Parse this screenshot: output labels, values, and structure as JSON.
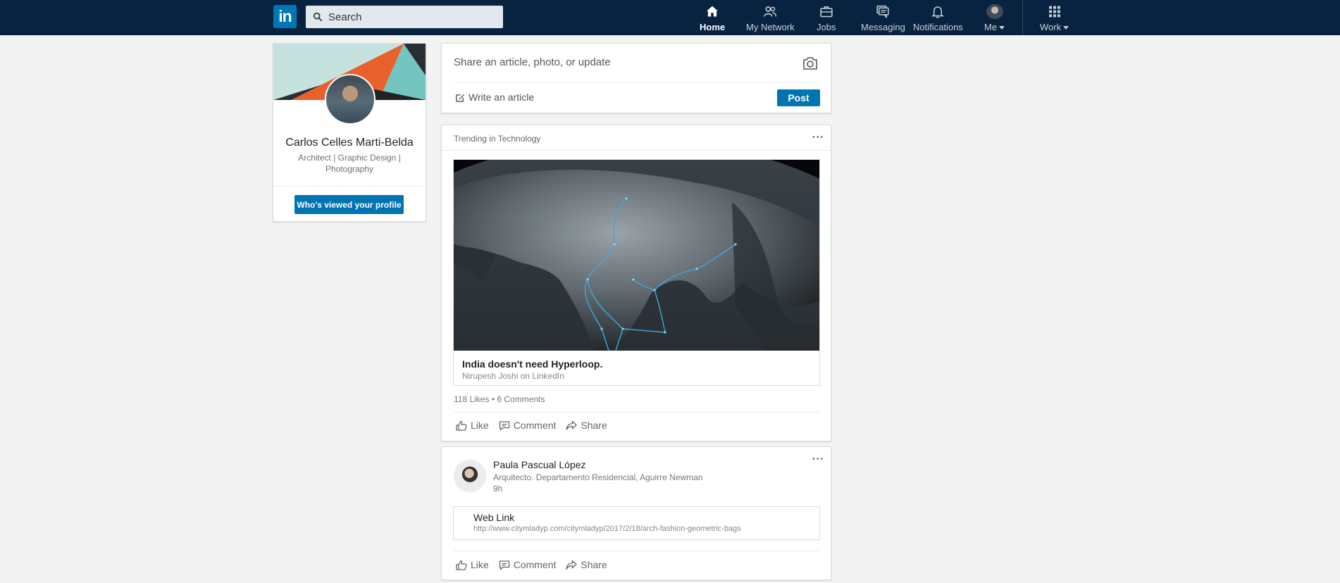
{
  "nav": {
    "logo_text": "in",
    "search_placeholder": "Search",
    "items": [
      {
        "label": "Home",
        "icon": "home-icon"
      },
      {
        "label": "My Network",
        "icon": "people-icon"
      },
      {
        "label": "Jobs",
        "icon": "briefcase-icon"
      },
      {
        "label": "Messaging",
        "icon": "chat-icon"
      },
      {
        "label": "Notifications",
        "icon": "bell-icon"
      },
      {
        "label": "Me",
        "icon": "avatar"
      },
      {
        "label": "Work",
        "icon": "grid-icon"
      }
    ]
  },
  "profile": {
    "name": "Carlos Celles Marti-Belda",
    "headline": "Architect | Graphic Design | Photography",
    "button": "Who's viewed your profile"
  },
  "share": {
    "placeholder": "Share an article, photo, or update",
    "write_article": "Write an article",
    "post_button": "Post"
  },
  "trending": {
    "header": "Trending in Technology",
    "more": "···",
    "article_title": "India doesn't need Hyperloop.",
    "article_source": "Nirupesh Joshi on LinkedIn",
    "social_counts": "118 Likes  •  6 Comments",
    "actions": {
      "like": "Like",
      "comment": "Comment",
      "share": "Share"
    }
  },
  "post": {
    "author": "Paula Pascual López",
    "headline": "Arquitecto. Departamento Residencial, Aguirre Newman",
    "time": "9h",
    "more": "···",
    "link_title": "Web Link",
    "link_url": "http://www.citymladyp.com/citymladyp/2017/2/18/arch-fashion-geometric-bags",
    "actions": {
      "like": "Like",
      "comment": "Comment",
      "share": "Share"
    }
  },
  "colors": {
    "nav_bg": "#08233f",
    "brand": "#0077b5",
    "button": "#0073b1",
    "page_bg": "#f3f3f3"
  }
}
